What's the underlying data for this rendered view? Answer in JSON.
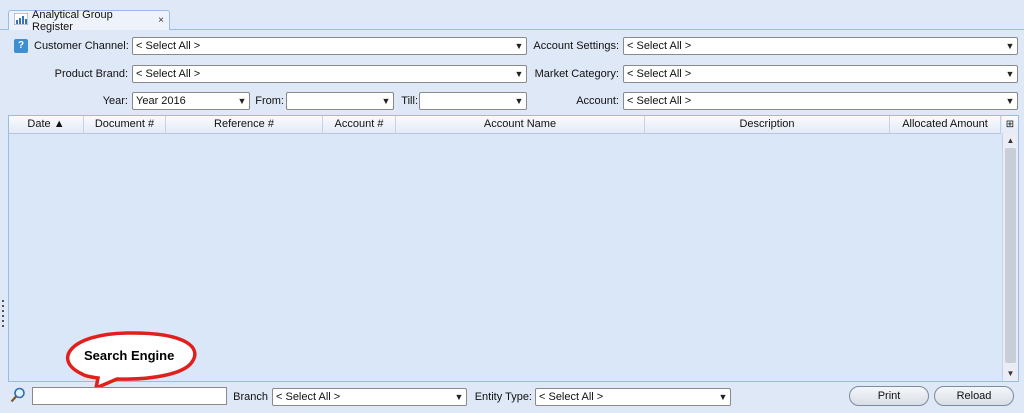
{
  "tab": {
    "title": "Analytical Group Register",
    "close": "×"
  },
  "filters": {
    "customer_channel": {
      "label": "Customer Channel:",
      "value": "< Select All >"
    },
    "account_settings": {
      "label": "Account Settings:",
      "value": "< Select All >"
    },
    "product_brand": {
      "label": "Product Brand:",
      "value": "< Select All >"
    },
    "market_category": {
      "label": "Market Category:",
      "value": "< Select All >"
    },
    "year": {
      "label": "Year:",
      "value": "Year 2016"
    },
    "from": {
      "label": "From:",
      "value": ""
    },
    "till": {
      "label": "Till:",
      "value": ""
    },
    "account": {
      "label": "Account:",
      "value": "< Select All >"
    }
  },
  "grid": {
    "columns": [
      "Date ▲",
      "Document #",
      "Reference #",
      "Account #",
      "Account Name",
      "Description",
      "Allocated Amount"
    ],
    "rows": []
  },
  "bottom": {
    "search_value": "",
    "branch": {
      "label": "Branch",
      "value": "< Select All >"
    },
    "entity_type": {
      "label": "Entity Type:",
      "value": "< Select All >"
    },
    "print": "Print",
    "reload": "Reload"
  },
  "annotation": {
    "text": "Search Engine",
    "color": "#e0201c"
  },
  "icons": {
    "tab": "chart-icon",
    "help": "help-icon",
    "search": "search-icon"
  },
  "colors": {
    "background": "#dfe8f6",
    "grid_body": "#d9e7f8",
    "border": "#99bbe8"
  }
}
